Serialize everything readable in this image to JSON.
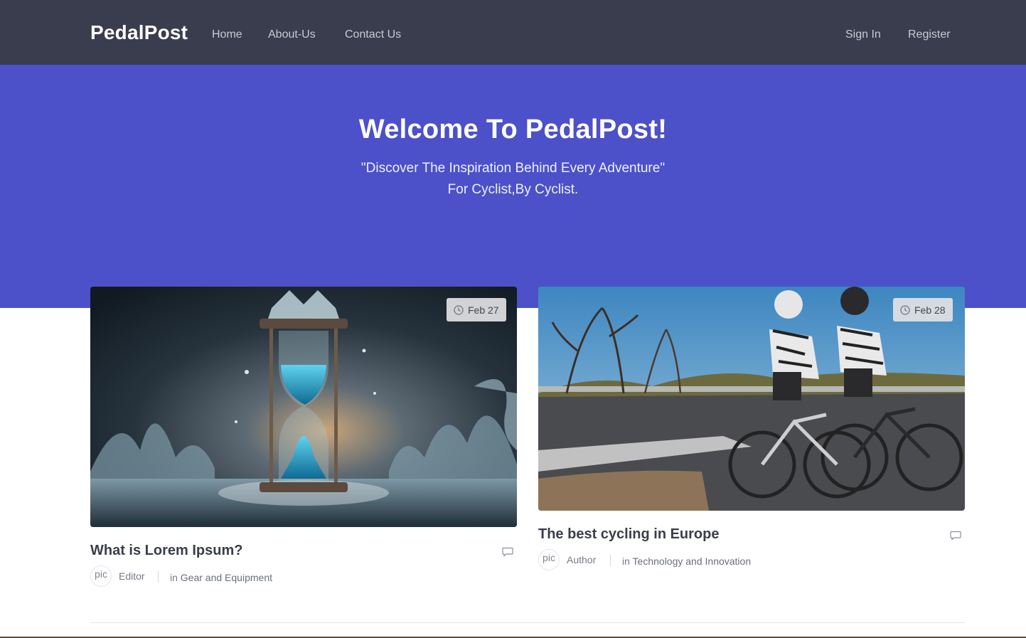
{
  "navbar": {
    "brand": "PedalPost",
    "links": [
      "Home",
      "About-Us",
      "Contact Us"
    ],
    "sign_in": "Sign In",
    "register": "Register"
  },
  "hero": {
    "title": "Welcome To PedalPost!",
    "subtitle_line1": "\"Discover The Inspiration Behind Every Adventure\"",
    "subtitle_line2": "For Cyclist,By Cyclist."
  },
  "posts": [
    {
      "date": "Feb 27",
      "title": "What is Lorem Ipsum?",
      "avatar_text": "pic",
      "author": "Editor",
      "category_prefix": "in",
      "category": "Gear and Equipment"
    },
    {
      "date": "Feb 28",
      "title": "The best cycling in Europe",
      "avatar_text": "pic",
      "author": "Author",
      "category_prefix": "in",
      "category": "Technology and Innovation"
    }
  ],
  "colors": {
    "navbar": "#393d4e",
    "hero": "#4c51c9",
    "text_dark": "#3a3e4b",
    "text_muted": "#777b86"
  }
}
